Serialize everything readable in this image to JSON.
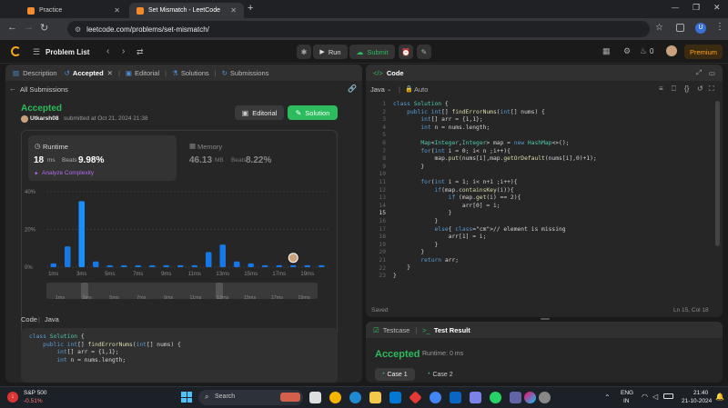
{
  "browser": {
    "tabs": [
      {
        "label": "Practice"
      },
      {
        "label": "Set Mismatch - LeetCode"
      }
    ],
    "url": "leetcode.com/problems/set-mismatch/"
  },
  "topbar": {
    "problem_list": "Problem List",
    "run": "Run",
    "submit": "Submit",
    "coins": "0",
    "premium": "Premium"
  },
  "left_tabs": {
    "description": "Description",
    "accepted": "Accepted",
    "editorial": "Editorial",
    "solutions": "Solutions",
    "submissions": "Submissions"
  },
  "submission": {
    "back": "All Submissions",
    "status": "Accepted",
    "user": "Utkarsh08",
    "submitted": "submitted at Oct 21, 2024 21:38",
    "editorial_btn": "Editorial",
    "solution_btn": "Solution",
    "runtime_label": "Runtime",
    "runtime_value": "18",
    "runtime_unit": "ms",
    "beats_label": "Beats",
    "runtime_beats": "9.98%",
    "analyze": "Analyze Complexity",
    "memory_label": "Memory",
    "memory_value": "46.13",
    "memory_unit": "MB",
    "memory_beats": "8.22%",
    "code_label": "Code",
    "lang": "Java"
  },
  "chart_data": {
    "type": "bar",
    "categories": [
      "1ms",
      "",
      "3ms",
      "",
      "5ms",
      "",
      "7ms",
      "",
      "9ms",
      "",
      "11ms",
      "",
      "13ms",
      "",
      "15ms",
      "",
      "17ms",
      "",
      "19ms",
      ""
    ],
    "values": [
      2,
      11,
      35,
      3,
      1,
      1,
      1,
      1,
      1,
      1,
      1,
      8,
      12,
      3,
      2,
      1,
      1,
      1,
      1,
      1
    ],
    "yticks": [
      "40%",
      "20%",
      "0%"
    ],
    "ylim": [
      0,
      40
    ],
    "highlight_index": 2,
    "brush_labels": [
      "1ms",
      "3ms",
      "5ms",
      "7ms",
      "9ms",
      "11ms",
      "13ms",
      "15ms",
      "17ms",
      "19ms"
    ]
  },
  "editor": {
    "title": "Code",
    "lang": "Java",
    "auto": "Auto",
    "saved": "Saved",
    "position": "Ln 15, Col 18",
    "lines": [
      "class Solution {",
      "    public int[] findErrorNums(int[] nums) {",
      "        int[] arr = {1,1};",
      "        int n = nums.length;",
      "",
      "        Map<Integer,Integer> map = new HashMap<>();",
      "        for(int i = 0; i< n ;i++){",
      "            map.put(nums[i],map.getOrDefault(nums[i],0)+1);",
      "        }",
      "",
      "        for(int i = 1; i< n+1 ;i++){",
      "            if(map.containsKey(i)){",
      "                if (map.get(i) == 2){",
      "                    arr[0] = i;",
      "                }",
      "            }",
      "            else{ // element is missing",
      "                arr[1] = i;",
      "            }",
      "        }",
      "        return arr;",
      "    }",
      "}"
    ]
  },
  "preview_code": [
    "class Solution {",
    "    public int[] findErrorNums(int[] nums) {",
    "        int[] arr = {1,1};",
    "        int n = nums.length;"
  ],
  "result": {
    "testcase": "Testcase",
    "test_result": "Test Result",
    "status": "Accepted",
    "runtime": "Runtime: 0 ms",
    "case1": "Case 1",
    "case2": "Case 2"
  },
  "taskbar": {
    "stock": "S&P 500",
    "stock_change": "-0.51%",
    "search": "Search",
    "lang1": "ENG",
    "lang2": "IN",
    "time": "21:40",
    "date": "21-10-2024"
  }
}
